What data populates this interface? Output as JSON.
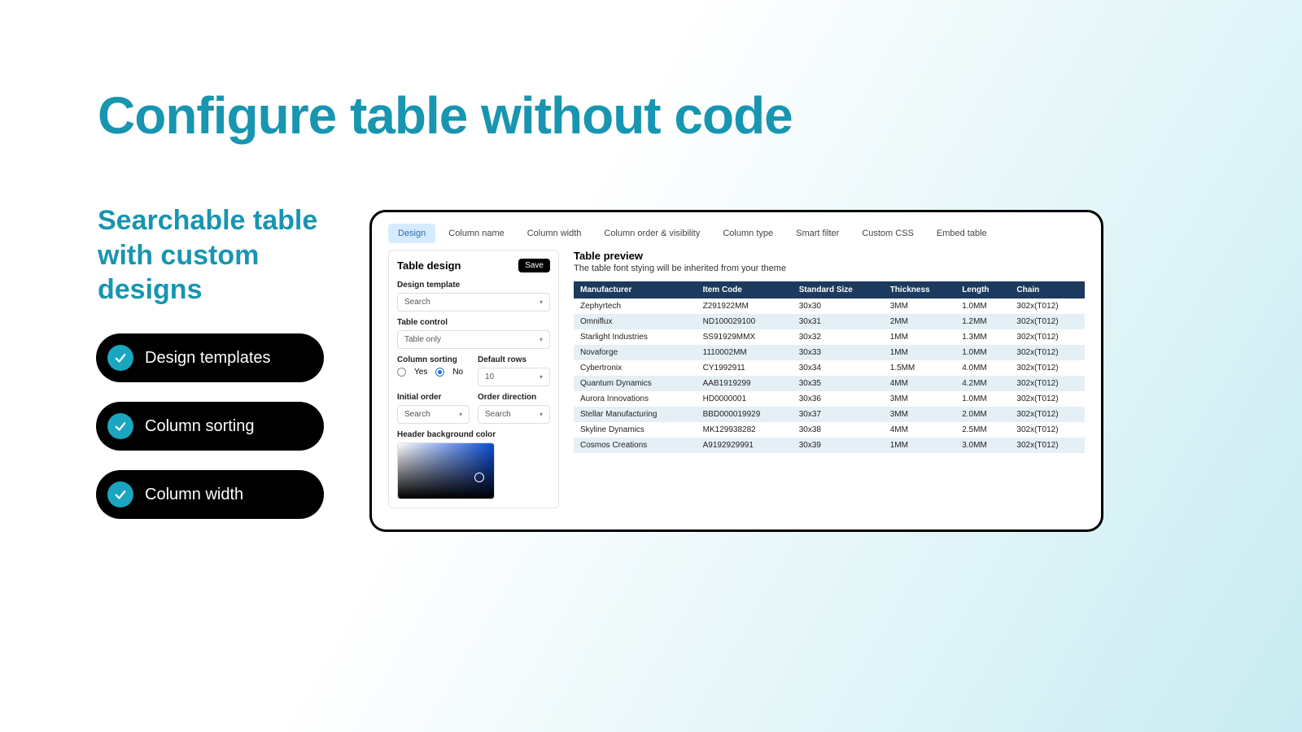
{
  "hero": {
    "title": "Configure table without code",
    "subtitle": "Searchable table with custom designs"
  },
  "pills": [
    "Design templates",
    "Column sorting",
    "Column width"
  ],
  "app": {
    "tabs": [
      "Design",
      "Column name",
      "Column width",
      "Column order & visibility",
      "Column type",
      "Smart filter",
      "Custom CSS",
      "Embed table"
    ],
    "leftPanel": {
      "title": "Table design",
      "saveLabel": "Save",
      "designTemplate": {
        "label": "Design template",
        "value": "Search"
      },
      "tableControl": {
        "label": "Table control",
        "value": "Table only"
      },
      "columnSorting": {
        "label": "Column sorting",
        "yes": "Yes",
        "no": "No",
        "selected": "No"
      },
      "defaultRows": {
        "label": "Default rows",
        "value": "10"
      },
      "initialOrder": {
        "label": "Initial order",
        "value": "Search"
      },
      "orderDirection": {
        "label": "Order direction",
        "value": "Search"
      },
      "headerBgColor": {
        "label": "Header background color"
      }
    },
    "preview": {
      "title": "Table preview",
      "sub": "The table font stying will be inherited from your theme",
      "columns": [
        "Manufacturer",
        "Item Code",
        "Standard Size",
        "Thickness",
        "Length",
        "Chain"
      ],
      "rows": [
        [
          "Zephyrtech",
          "Z291922MM",
          "30x30",
          "3MM",
          "1.0MM",
          "302x(T012)"
        ],
        [
          "Omniflux",
          "ND100029100",
          "30x31",
          "2MM",
          "1.2MM",
          "302x(T012)"
        ],
        [
          "Starlight Industries",
          "SS91929MMX",
          "30x32",
          "1MM",
          "1.3MM",
          "302x(T012)"
        ],
        [
          "Novaforge",
          "1110002MM",
          "30x33",
          "1MM",
          "1.0MM",
          "302x(T012)"
        ],
        [
          "Cybertronix",
          "CY1992911",
          "30x34",
          "1.5MM",
          "4.0MM",
          "302x(T012)"
        ],
        [
          "Quantum Dynamics",
          "AAB1919299",
          "30x35",
          "4MM",
          "4.2MM",
          "302x(T012)"
        ],
        [
          "Aurora Innovations",
          "HD0000001",
          "30x36",
          "3MM",
          "1.0MM",
          "302x(T012)"
        ],
        [
          "Stellar Manufacturing",
          "BBD000019929",
          "30x37",
          "3MM",
          "2.0MM",
          "302x(T012)"
        ],
        [
          "Skyline Dynamics",
          "MK129938282",
          "30x38",
          "4MM",
          "2.5MM",
          "302x(T012)"
        ],
        [
          "Cosmos Creations",
          "A9192929991",
          "30x39",
          "1MM",
          "3.0MM",
          "302x(T012)"
        ]
      ]
    }
  }
}
